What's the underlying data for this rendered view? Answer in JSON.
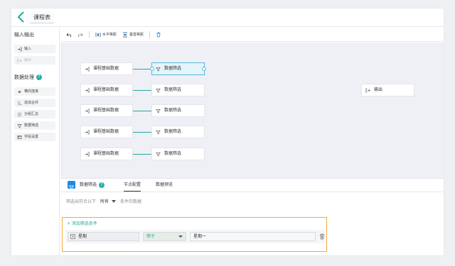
{
  "header": {
    "title": "课程表"
  },
  "sidebar": {
    "group_io": {
      "title": "输入输出",
      "items": [
        {
          "label": "输入"
        },
        {
          "label": "输出"
        }
      ]
    },
    "group_proc": {
      "title": "数据处理",
      "items": [
        {
          "label": "横向连接"
        },
        {
          "label": "追加合并"
        },
        {
          "label": "分组汇总"
        },
        {
          "label": "数据筛选"
        },
        {
          "label": "字段设置"
        }
      ]
    }
  },
  "toolbar": {
    "horizontal_label": "水平等距",
    "vertical_label": "垂直等距"
  },
  "canvas": {
    "source_nodes": [
      "课程基础数据",
      "课程基础数据",
      "课程基础数据",
      "课程基础数据",
      "课程基础数据"
    ],
    "filter_nodes": [
      "数据筛选",
      "数据筛选",
      "数据筛选",
      "数据筛选",
      "数据筛选"
    ],
    "output_node": "输出"
  },
  "panel": {
    "node_name": "数据筛选",
    "tabs": [
      "节点配置",
      "数据预览"
    ],
    "filter_prefix": "筛选出符合以下",
    "filter_mode": "所有",
    "filter_suffix": "条件的数据",
    "add_condition": "+ 添加筛选条件",
    "condition": {
      "field": "星期",
      "operator": "等于",
      "value": "星期一"
    }
  },
  "colors": {
    "accent": "#2aa7a0",
    "selected_border": "#55b7de",
    "highlight_border": "#f3a93a",
    "panel_icon": "#1e88e5"
  }
}
